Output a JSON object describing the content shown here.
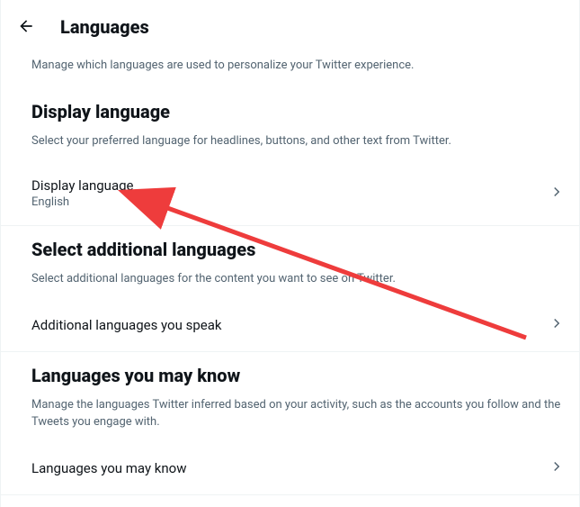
{
  "header": {
    "title": "Languages"
  },
  "intro": "Manage which languages are used to personalize your Twitter experience.",
  "section1": {
    "title": "Display language",
    "desc": "Select your preferred language for headlines, buttons, and other text from Twitter.",
    "row": {
      "label": "Display language",
      "value": "English"
    }
  },
  "section2": {
    "title": "Select additional languages",
    "desc": "Select additional languages for the content you want to see on Twitter.",
    "row": {
      "label": "Additional languages you speak"
    }
  },
  "section3": {
    "title": "Languages you may know",
    "desc": "Manage the languages Twitter inferred based on your activity, such as the accounts you follow and the Tweets you engage with.",
    "row": {
      "label": "Languages you may know"
    }
  },
  "annotation": {
    "color": "#ee3c3c"
  }
}
